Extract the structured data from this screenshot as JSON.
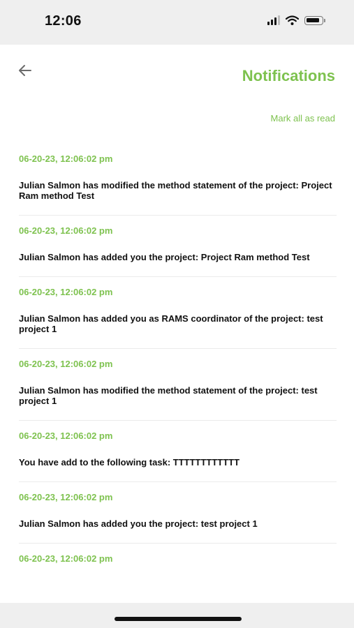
{
  "status_bar": {
    "time": "12:06"
  },
  "header": {
    "title": "Notifications",
    "mark_all": "Mark all as read"
  },
  "notifications": [
    {
      "date": "06-20-23, 12:06:02 pm",
      "text": "Julian Salmon has modified the method statement of the project: Project Ram method Test"
    },
    {
      "date": "06-20-23, 12:06:02 pm",
      "text": "Julian Salmon has added you the project: Project Ram method Test"
    },
    {
      "date": "06-20-23, 12:06:02 pm",
      "text": "Julian Salmon has added you as RAMS coordinator of the project: test project 1"
    },
    {
      "date": "06-20-23, 12:06:02 pm",
      "text": "Julian Salmon has modified the method statement of the project: test project 1"
    },
    {
      "date": "06-20-23, 12:06:02 pm",
      "text": "You have add to the following task: TTTTTTTTTTTT"
    },
    {
      "date": "06-20-23, 12:06:02 pm",
      "text": "Julian Salmon has added you the project: test project 1"
    },
    {
      "date": "06-20-23, 12:06:02 pm",
      "text": ""
    }
  ],
  "colors": {
    "accent": "#7ec24f",
    "text": "#111111",
    "divider": "#ebebeb"
  },
  "icons": [
    "back-arrow-icon",
    "cellular-signal-icon",
    "wifi-icon",
    "battery-icon"
  ]
}
